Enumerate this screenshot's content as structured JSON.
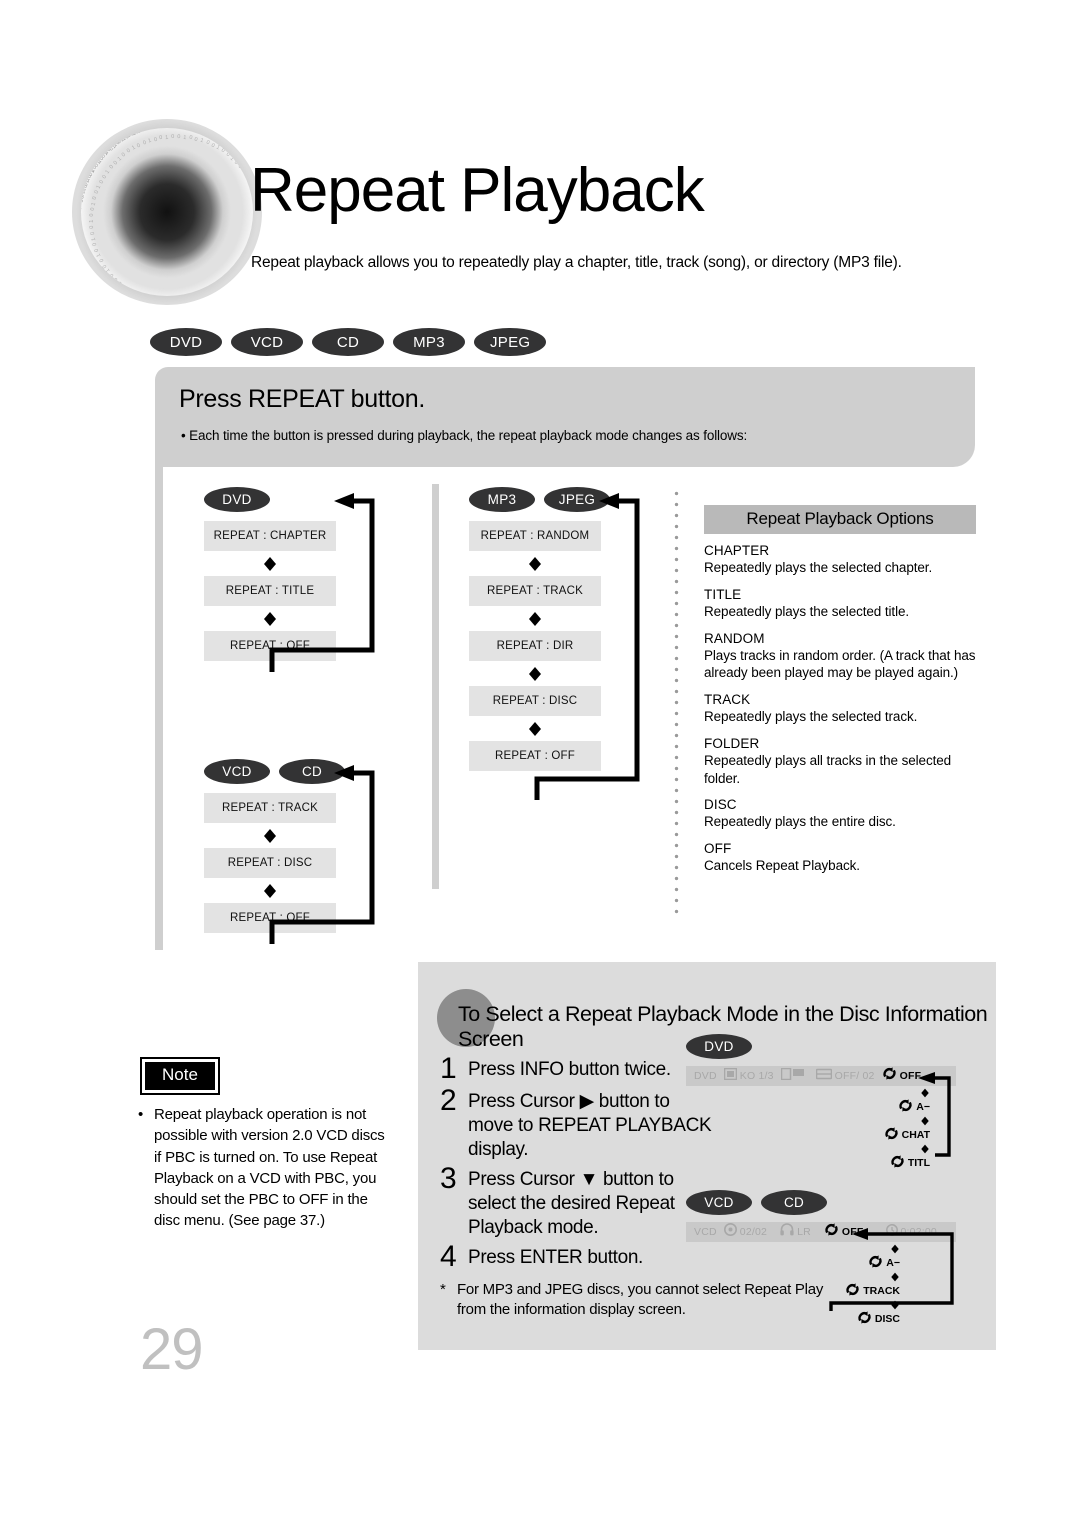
{
  "header": {
    "title": "Repeat Playback",
    "subtitle": "Repeat playback allows you to repeatedly play a chapter, title, track (song), or directory (MP3 file).",
    "disc_badges": [
      "DVD",
      "VCD",
      "CD",
      "MP3",
      "JPEG"
    ]
  },
  "band": {
    "title": "Press REPEAT button.",
    "bullet": "• Each time the button is pressed during playback, the repeat playback mode changes as follows:"
  },
  "flows": [
    {
      "id": "dvd",
      "badges": [
        "DVD"
      ],
      "steps": [
        "REPEAT : CHAPTER",
        "REPEAT : TITLE",
        "REPEAT : OFF"
      ]
    },
    {
      "id": "vcd-cd",
      "badges": [
        "VCD",
        "CD"
      ],
      "steps": [
        "REPEAT : TRACK",
        "REPEAT : DISC",
        "REPEAT : OFF"
      ]
    },
    {
      "id": "mp3-jpeg",
      "badges": [
        "MP3",
        "JPEG"
      ],
      "steps": [
        "REPEAT : RANDOM",
        "REPEAT : TRACK",
        "REPEAT : DIR",
        "REPEAT : DISC",
        "REPEAT : OFF"
      ]
    }
  ],
  "options": {
    "title": "Repeat Playback Options",
    "items": [
      {
        "key": "CHAPTER",
        "desc": "Repeatedly plays the selected chapter."
      },
      {
        "key": "TITLE",
        "desc": "Repeatedly plays the selected title."
      },
      {
        "key": "RANDOM",
        "desc": "Plays tracks in random order.\n(A track that has already been played may be played again.)"
      },
      {
        "key": "TRACK",
        "desc": "Repeatedly plays the selected track."
      },
      {
        "key": "FOLDER",
        "desc": "Repeatedly plays all tracks in the selected folder."
      },
      {
        "key": "DISC",
        "desc": "Repeatedly plays the entire disc."
      },
      {
        "key": "OFF",
        "desc": "Cancels Repeat Playback."
      }
    ]
  },
  "note": {
    "label": "Note",
    "bullet": "•",
    "text": "Repeat playback operation is not possible with version 2.0 VCD discs if PBC is turned on. To use Repeat Playback on a VCD with PBC, you should set the PBC to OFF in the disc menu. (See page 37.)"
  },
  "page_number": "29",
  "bottom": {
    "title": "To Select a Repeat Playback Mode in the Disc Information Screen",
    "steps": [
      {
        "n": "1",
        "text": "Press INFO button twice."
      },
      {
        "n": "2",
        "text": "Press Cursor ▶ button to move to REPEAT PLAYBACK display."
      },
      {
        "n": "3",
        "text": "Press Cursor ▼ button to select the desired Repeat Playback mode."
      },
      {
        "n": "4",
        "text": "Press ENTER button."
      }
    ],
    "footnote_marker": "*",
    "footnote": "For MP3 and JPEG discs, you cannot select Repeat Play from the information display screen.",
    "osd_dvd": {
      "badges": [
        "DVD"
      ],
      "fields": [
        "DVD",
        "KO 1/3",
        "OFF/ 02"
      ],
      "selected": "OFF",
      "chain": [
        "A−",
        "CHAT",
        "TITL"
      ]
    },
    "osd_vcd": {
      "badges": [
        "VCD",
        "CD"
      ],
      "fields": [
        "VCD",
        "02/02",
        "LR"
      ],
      "selected": "OFF",
      "time": "0:02:00",
      "chain": [
        "A−",
        "TRACK",
        "DISC"
      ]
    }
  },
  "colors": {
    "badge_bg": "#333334",
    "band_bg": "#cfcfcf",
    "box_bg": "#e3e3e3",
    "panel_bg": "#dcdcdc",
    "options_title_bg": "#b9b9b9",
    "osd_bg": "#c9c9c9",
    "page_number": "#c0c0c0"
  }
}
